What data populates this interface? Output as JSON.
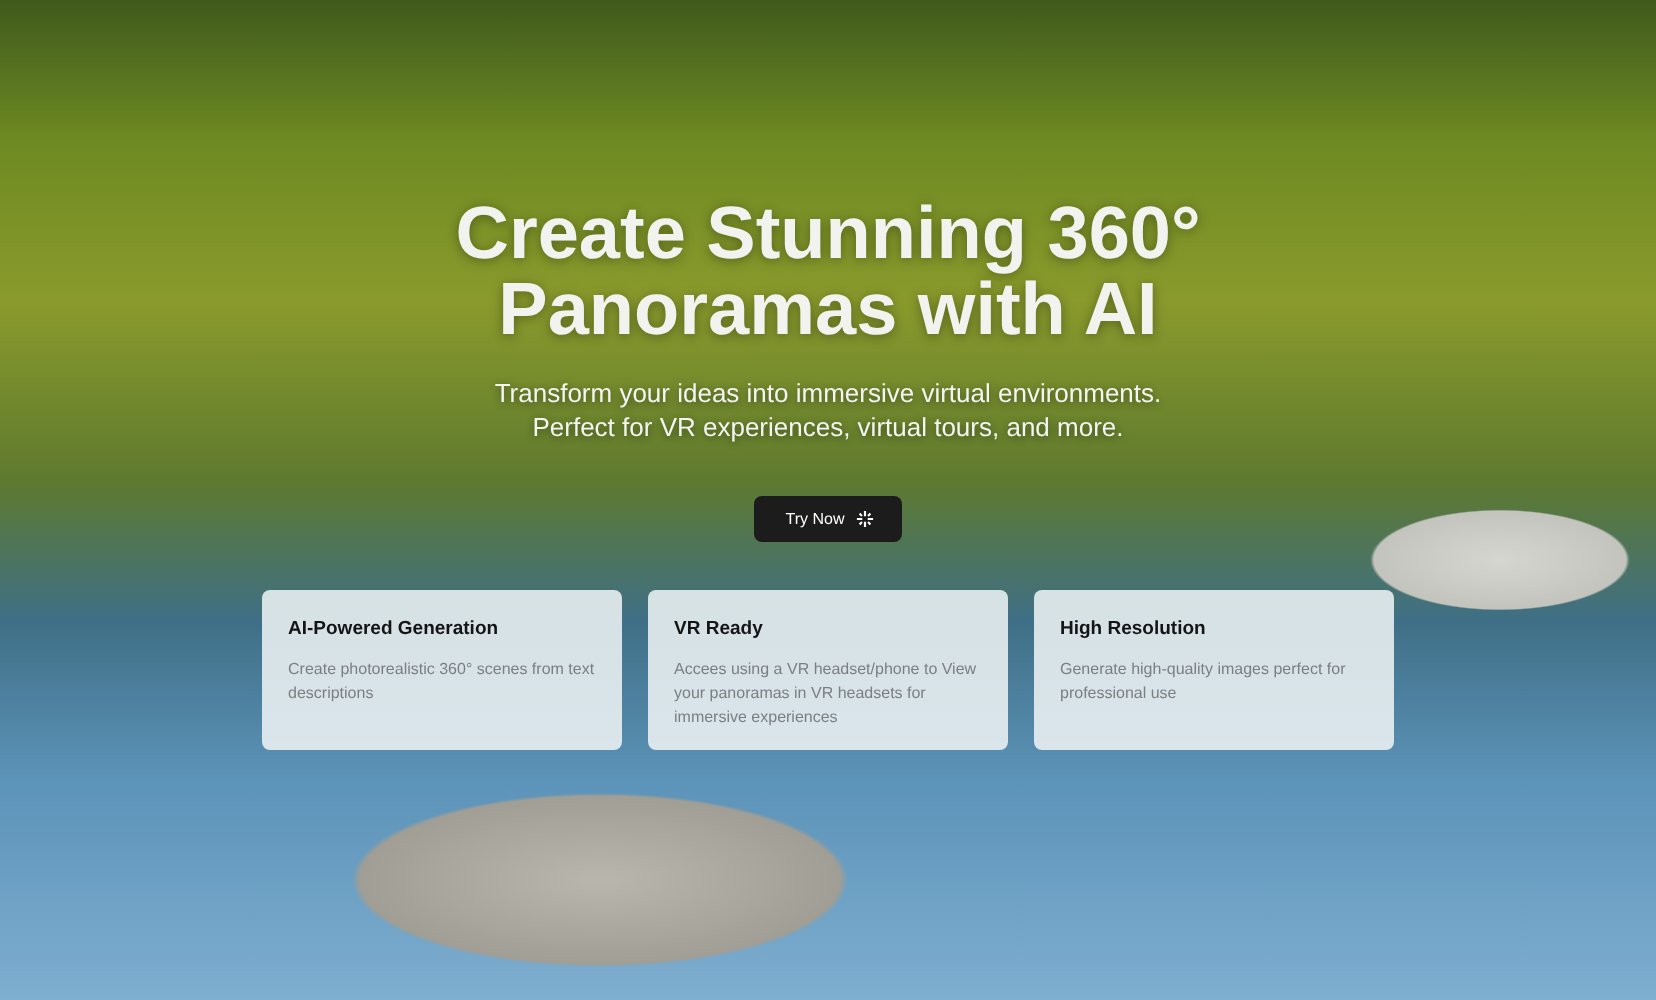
{
  "hero": {
    "title_lines": [
      "Create Stunning 360°",
      "Panoramas with AI"
    ],
    "subtitle_lines": [
      "Transform your ideas into immersive virtual environments.",
      "Perfect for VR experiences, virtual tours, and more."
    ],
    "button": {
      "label": "Try Now"
    }
  },
  "features": [
    {
      "title": "AI-Powered Generation",
      "description": "Create photorealistic 360° scenes from text descriptions"
    },
    {
      "title": "VR Ready",
      "description": "Accees using a VR headset/phone to View your panoramas in VR headsets for immersive experiences"
    },
    {
      "title": "High Resolution",
      "description": "Generate high-quality images perfect for professional use"
    }
  ]
}
